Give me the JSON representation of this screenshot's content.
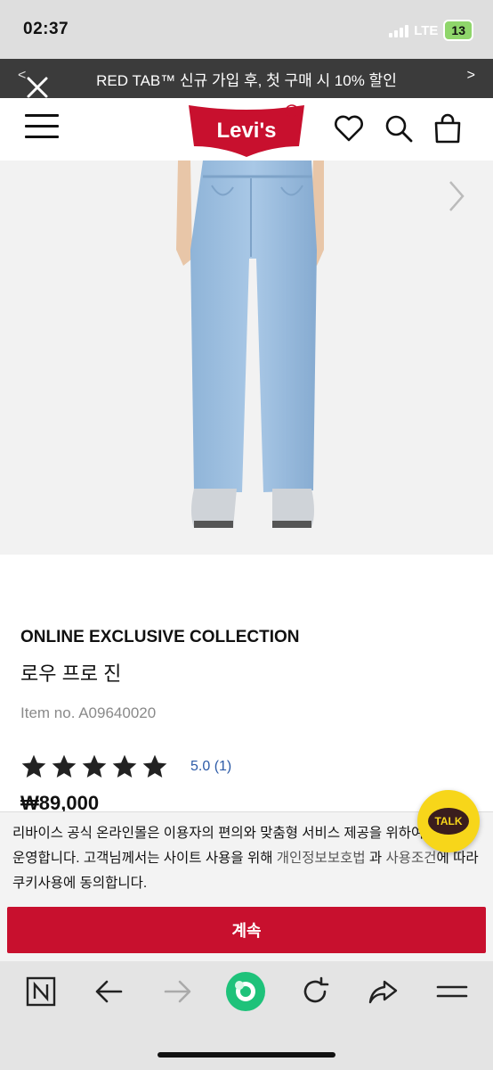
{
  "status_bar": {
    "time": "02:37",
    "network": "LTE",
    "battery": "13"
  },
  "promo": {
    "text": "RED TAB™ 신규 가입 후, 첫 구매 시 10% 할인",
    "prev": "<",
    "next": ">"
  },
  "header": {
    "logo_text": "Levi's",
    "icons": [
      "close-icon",
      "menu-icon",
      "heart-icon",
      "search-icon",
      "bag-icon"
    ]
  },
  "product": {
    "collection": "ONLINE EXCLUSIVE COLLECTION",
    "name": "로우 프로 진",
    "item_no": "Item no. A09640020",
    "stars": 5,
    "rating": "5.0 (1)",
    "price": "₩89,000"
  },
  "cookie_notice": {
    "text_part1": "리바이스 공식 온라인몰은 이용자의 편의와 맞춤형 서비스 제공을 위하여 쿠키를 운영합니다. 고객님께서는 사이트 사용을 위해 ",
    "link1": "개인정보보호법",
    "text_part2": " 과 ",
    "link2": "사용조건",
    "text_part3": "에 따라 쿠키사용에 동의합니다.",
    "button": "계속"
  },
  "talk": {
    "label": "TALK",
    "color": "#f7d61a"
  },
  "colors": {
    "brand_red": "#c8102e",
    "promo_bg": "#3b3b3b",
    "rating_blue": "#2d5ba7"
  },
  "toolbar": {
    "icons": [
      "naver-icon",
      "back-arrow-icon",
      "forward-arrow-icon",
      "green-dot-icon",
      "reload-icon",
      "share-icon",
      "menu-lines-icon"
    ]
  }
}
